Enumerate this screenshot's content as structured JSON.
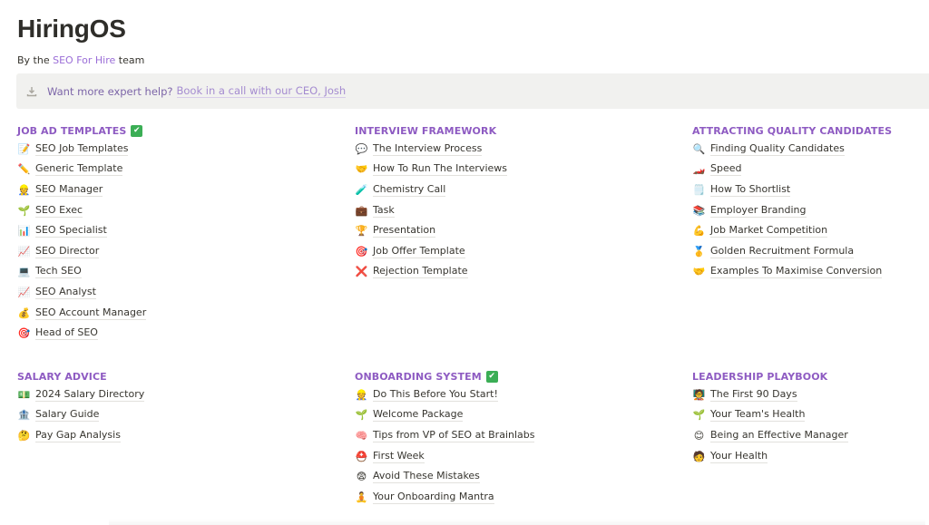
{
  "header": {
    "title": "HiringOS",
    "byline_prefix": "By the",
    "byline_link": "SEO For Hire",
    "byline_suffix": "team"
  },
  "callout": {
    "icon": "download-icon",
    "text": "Want more expert help?",
    "link": "Book in a call with our CEO, Josh"
  },
  "sections": [
    {
      "title": "JOB AD TEMPLATES",
      "check": true,
      "items": [
        {
          "icon": "memo-icon",
          "emoji": "📝",
          "label": "SEO Job Templates"
        },
        {
          "icon": "pencil-icon",
          "emoji": "✏️",
          "label": "Generic Template"
        },
        {
          "icon": "manager-icon",
          "emoji": "👷",
          "label": "SEO Manager"
        },
        {
          "icon": "seedling-icon",
          "emoji": "🌱",
          "label": "SEO Exec"
        },
        {
          "icon": "bar-chart-icon",
          "emoji": "📊",
          "label": "SEO Specialist"
        },
        {
          "icon": "trending-up-icon",
          "emoji": "📈",
          "label": "SEO Director"
        },
        {
          "icon": "laptop-icon",
          "emoji": "💻",
          "label": "Tech SEO"
        },
        {
          "icon": "trending-up-icon",
          "emoji": "📈",
          "label": "SEO Analyst"
        },
        {
          "icon": "money-bag-icon",
          "emoji": "💰",
          "label": "SEO Account Manager"
        },
        {
          "icon": "target-icon",
          "emoji": "🎯",
          "label": "Head of SEO"
        }
      ]
    },
    {
      "title": "INTERVIEW FRAMEWORK",
      "check": false,
      "items": [
        {
          "icon": "speech-bubble-icon",
          "emoji": "💬",
          "label": "The Interview Process"
        },
        {
          "icon": "handshake-icon",
          "emoji": "🤝",
          "label": "How To Run The Interviews"
        },
        {
          "icon": "test-tube-icon",
          "emoji": "🧪",
          "label": "Chemistry Call"
        },
        {
          "icon": "briefcase-icon",
          "emoji": "💼",
          "label": "Task"
        },
        {
          "icon": "trophy-icon",
          "emoji": "🏆",
          "label": "Presentation"
        },
        {
          "icon": "target-icon",
          "emoji": "🎯",
          "label": "Job Offer Template"
        },
        {
          "icon": "cross-mark-icon",
          "emoji": "❌",
          "label": "Rejection Template"
        }
      ]
    },
    {
      "title": "ATTRACTING QUALITY CANDIDATES",
      "check": false,
      "items": [
        {
          "icon": "magnifier-icon",
          "emoji": "🔍",
          "label": "Finding Quality Candidates"
        },
        {
          "icon": "race-car-icon",
          "emoji": "🏎️",
          "label": "Speed"
        },
        {
          "icon": "notepad-icon",
          "emoji": "🗒️",
          "label": "How To Shortlist"
        },
        {
          "icon": "books-icon",
          "emoji": "📚",
          "label": "Employer Branding"
        },
        {
          "icon": "flexed-bicep-icon",
          "emoji": "💪",
          "label": "Job Market Competition"
        },
        {
          "icon": "gold-medal-icon",
          "emoji": "🥇",
          "label": "Golden Recruitment Formula"
        },
        {
          "icon": "handshake-icon",
          "emoji": "🤝",
          "label": "Examples To Maximise Conversion"
        }
      ]
    },
    {
      "title": "SALARY ADVICE",
      "check": false,
      "items": [
        {
          "icon": "banknote-icon",
          "emoji": "💵",
          "label": "2024 Salary Directory"
        },
        {
          "icon": "bank-icon",
          "emoji": "🏦",
          "label": "Salary Guide"
        },
        {
          "icon": "thinking-face-icon",
          "emoji": "🤔",
          "label": "Pay Gap Analysis"
        }
      ]
    },
    {
      "title": "ONBOARDING SYSTEM",
      "check": true,
      "items": [
        {
          "icon": "manager-icon",
          "emoji": "👷",
          "label": "Do This Before You Start!"
        },
        {
          "icon": "seedling-icon",
          "emoji": "🌱",
          "label": "Welcome Package"
        },
        {
          "icon": "brain-icon",
          "emoji": "🧠",
          "label": "Tips from VP of SEO at Brainlabs"
        },
        {
          "icon": "hard-hat-icon",
          "emoji": "⛑️",
          "label": "First Week"
        },
        {
          "icon": "scared-face-icon",
          "emoji": "😨",
          "label": "Avoid These Mistakes"
        },
        {
          "icon": "meditation-icon",
          "emoji": "🧘",
          "label": "Your Onboarding Mantra"
        }
      ]
    },
    {
      "title": "LEADERSHIP PLAYBOOK",
      "check": false,
      "items": [
        {
          "icon": "teacher-icon",
          "emoji": "🧑‍🏫",
          "label": "The First 90 Days"
        },
        {
          "icon": "seedling-icon",
          "emoji": "🌱",
          "label": "Your Team's Health"
        },
        {
          "icon": "smile-face-icon",
          "emoji": "😊",
          "label": "Being an Effective Manager"
        },
        {
          "icon": "person-icon",
          "emoji": "🧑",
          "label": "Your Health"
        }
      ]
    }
  ]
}
